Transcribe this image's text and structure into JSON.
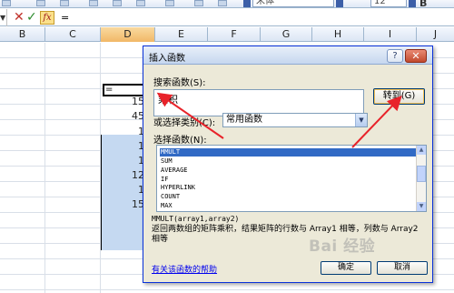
{
  "toolbar": {
    "font_name": "宋体",
    "font_size": "12",
    "bold_label": "B"
  },
  "formula_bar": {
    "cancel_symbol": "✕",
    "enter_symbol": "✓",
    "fx_label": "fx",
    "content": "="
  },
  "columns": [
    "B",
    "C",
    "D",
    "E",
    "F",
    "G",
    "H",
    "I",
    "J"
  ],
  "active_column": "D",
  "cells": {
    "editing_value": "=",
    "d_values": [
      "15",
      "45",
      "1",
      "1",
      "1",
      "12",
      "1",
      "15"
    ]
  },
  "dialog": {
    "title": "插入函数",
    "help_button": "?",
    "close_button": "✕",
    "search_label": "搜索函数(S):",
    "search_value": "乘积",
    "goto_button": "转到(G)",
    "category_label": "或选择类别(C):",
    "category_value": "常用函数",
    "function_list_label": "选择函数(N):",
    "functions": [
      "MMULT",
      "SUM",
      "AVERAGE",
      "IF",
      "HYPERLINK",
      "COUNT",
      "MAX"
    ],
    "selected_function": "MMULT",
    "syntax": "MMULT(array1,array2)",
    "description": "返回两数组的矩阵乘积，结果矩阵的行数与 Array1 相等，列数与 Array2 相等",
    "help_link": "有关该函数的帮助",
    "ok_button": "确定",
    "cancel_button": "取消"
  },
  "watermark": "Bai 经验",
  "colors": {
    "accent_red": "#e8232a",
    "selection_blue": "#316ac5",
    "cell_selection": "#c5d9f1",
    "dialog_bg": "#ece9d8"
  }
}
